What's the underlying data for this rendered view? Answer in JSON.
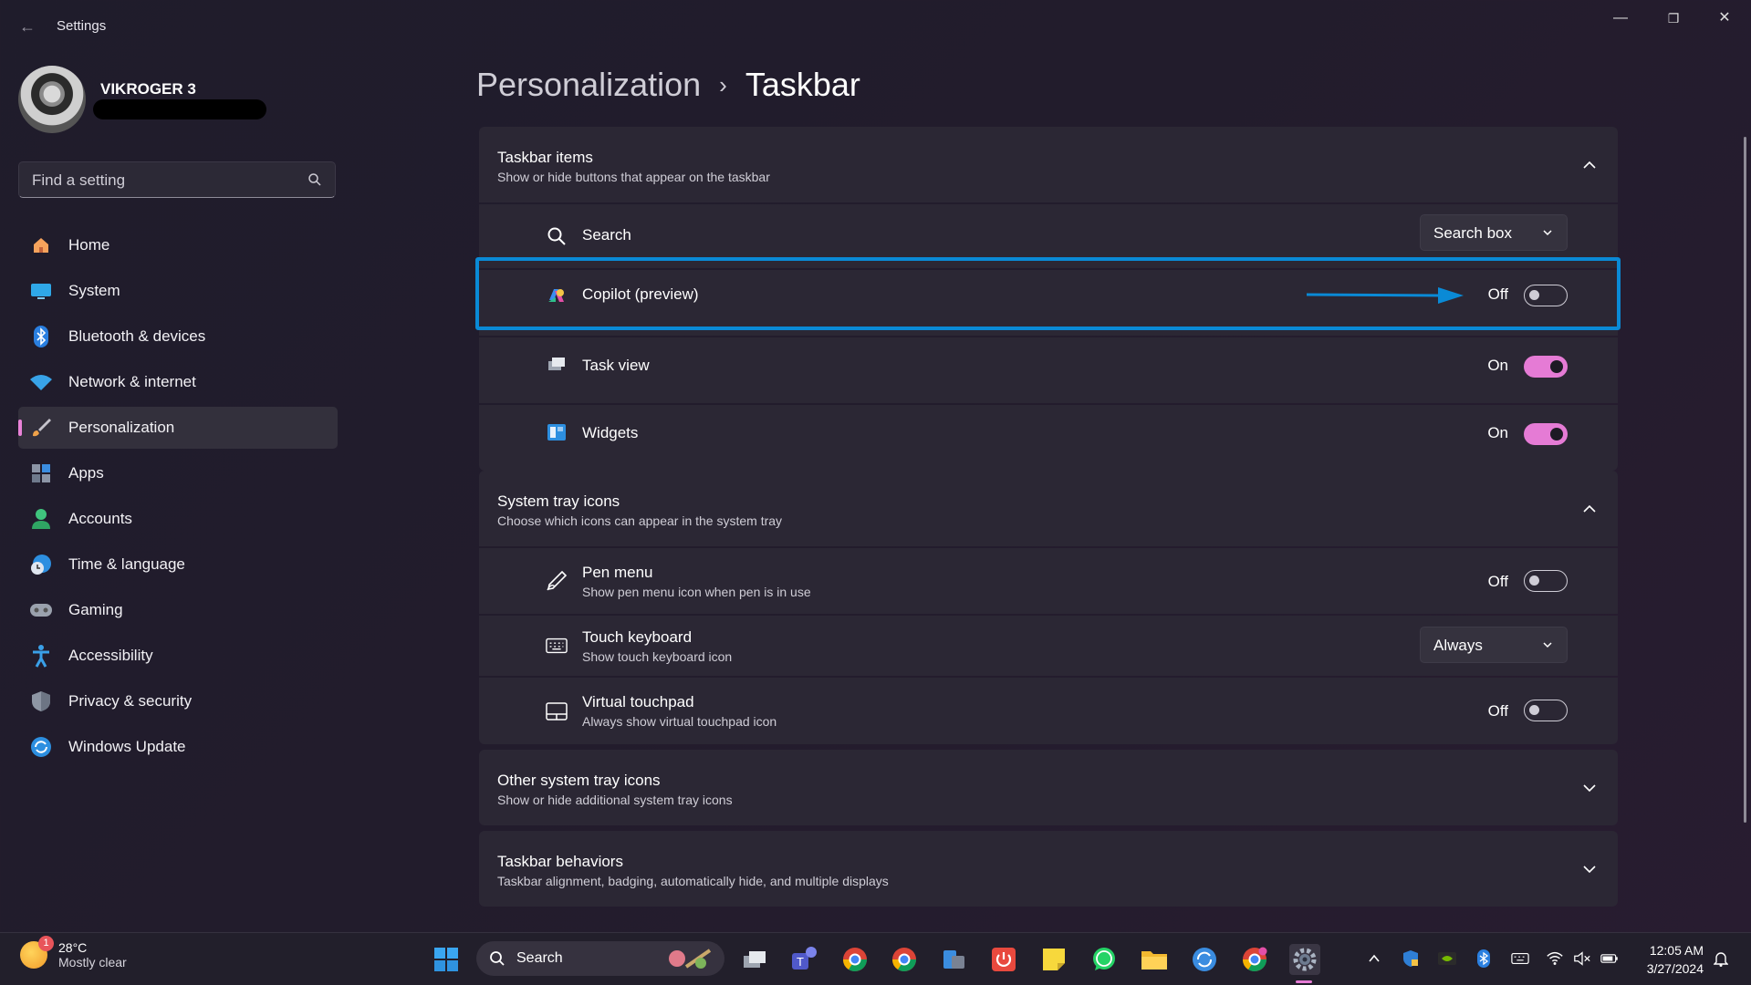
{
  "window": {
    "title": "Settings",
    "back": "←",
    "min": "—",
    "max": "❐",
    "close": "✕"
  },
  "user": {
    "name": "VIKROGER 3"
  },
  "search": {
    "placeholder": "Find a setting"
  },
  "nav": [
    {
      "label": "Home",
      "icon": "home-icon"
    },
    {
      "label": "System",
      "icon": "system-icon"
    },
    {
      "label": "Bluetooth & devices",
      "icon": "bluetooth-icon"
    },
    {
      "label": "Network & internet",
      "icon": "wifi-icon"
    },
    {
      "label": "Personalization",
      "icon": "brush-icon",
      "active": true
    },
    {
      "label": "Apps",
      "icon": "apps-icon"
    },
    {
      "label": "Accounts",
      "icon": "accounts-icon"
    },
    {
      "label": "Time & language",
      "icon": "clock-globe-icon"
    },
    {
      "label": "Gaming",
      "icon": "gamepad-icon"
    },
    {
      "label": "Accessibility",
      "icon": "accessibility-icon"
    },
    {
      "label": "Privacy & security",
      "icon": "shield-icon"
    },
    {
      "label": "Windows Update",
      "icon": "update-icon"
    }
  ],
  "breadcrumb": {
    "parent": "Personalization",
    "sep": "›",
    "current": "Taskbar"
  },
  "taskbar_items": {
    "title": "Taskbar items",
    "subtitle": "Show or hide buttons that appear on the taskbar",
    "search": {
      "label": "Search",
      "value": "Search box"
    },
    "copilot": {
      "label": "Copilot (preview)",
      "state": "Off"
    },
    "task_view": {
      "label": "Task view",
      "state": "On"
    },
    "widgets": {
      "label": "Widgets",
      "state": "On"
    }
  },
  "system_tray": {
    "title": "System tray icons",
    "subtitle": "Choose which icons can appear in the system tray",
    "pen_menu": {
      "label": "Pen menu",
      "sub": "Show pen menu icon when pen is in use",
      "state": "Off"
    },
    "touch_keyboard": {
      "label": "Touch keyboard",
      "sub": "Show touch keyboard icon",
      "value": "Always"
    },
    "virtual_touchpad": {
      "label": "Virtual touchpad",
      "sub": "Always show virtual touchpad icon",
      "state": "Off"
    }
  },
  "other_tray": {
    "title": "Other system tray icons",
    "subtitle": "Show or hide additional system tray icons"
  },
  "behaviors": {
    "title": "Taskbar behaviors",
    "subtitle": "Taskbar alignment, badging, automatically hide, and multiple displays"
  },
  "taskbar": {
    "weather": {
      "temp": "28°C",
      "desc": "Mostly clear",
      "badge": "1"
    },
    "search_label": "Search",
    "teams_badge": "1",
    "time": "12:05 AM",
    "date": "3/27/2024"
  },
  "colors": {
    "accent": "#e57bd5",
    "highlight": "#0a8ad6"
  }
}
